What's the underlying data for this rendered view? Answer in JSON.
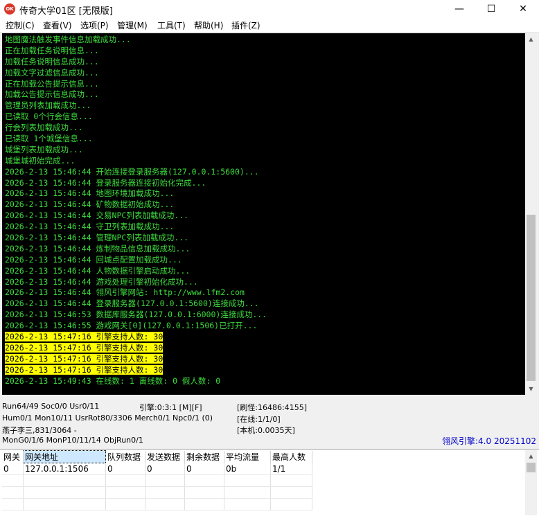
{
  "window": {
    "icon_text": "OK",
    "title": "传奇大学01区 [无限版]",
    "controls": {
      "minimize": "—",
      "maximize": "☐",
      "close": "✕"
    }
  },
  "menu": [
    "控制(C)",
    "查看(V)",
    "选项(P)",
    "管理(M)",
    "工具(T)",
    "帮助(H)",
    "插件(Z)"
  ],
  "console": {
    "text_color": "#3ddc3d",
    "highlight_color": "#ffff00",
    "lines": [
      "地图魔法触发事件信息加载成功...",
      "正在加载任务说明信息...",
      "加载任务说明信息成功...",
      "加载文字过滤信息成功...",
      "正在加载公告提示信息...",
      "加载公告提示信息成功...",
      "管理员列表加载成功...",
      "已读取 0个行会信息...",
      "行会列表加载成功...",
      "已读取 1个城堡信息...",
      "城堡列表加载成功...",
      "城堡城初始完成...",
      "2026-2-13 15:46:44 开始连接登录服务器(127.0.0.1:5600)...",
      "2026-2-13 15:46:44 登录服务器连接初始化完成...",
      "2026-2-13 15:46:44 地图环境加载成功...",
      "2026-2-13 15:46:44 矿物数据初始成功...",
      "2026-2-13 15:46:44 交易NPC列表加载成功...",
      "2026-2-13 15:46:44 守卫列表加载成功...",
      "2026-2-13 15:46:44 管理NPC列表加载成功...",
      "2026-2-13 15:46:44 炼制物品信息加载成功...",
      "2026-2-13 15:46:44 回城点配置加载成功...",
      "2026-2-13 15:46:44 人物数据引擎启动成功...",
      "2026-2-13 15:46:44 游戏处理引擎初始化成功...",
      "2026-2-13 15:46:44 翎风引擎网站: http://www.lfm2.com",
      "2026-2-13 15:46:44 登录服务器(127.0.0.1:5600)连接成功...",
      "2026-2-13 15:46:53 数据库服务器(127.0.0.1:6000)连接成功...",
      "2026-2-13 15:46:55 游戏网关[0](127.0.0.1:1506)已打开...",
      "2026-2-13 15:47:16 引擎支持人数: 30",
      "2026-2-13 15:47:16 引擎支持人数: 30",
      "2026-2-13 15:47:16 引擎支持人数: 30",
      "2026-2-13 15:47:16 引擎支持人数: 30",
      "2026-2-13 15:49:43 在线数: 1 离线数: 0 假人数: 0"
    ],
    "highlighted_lines": [
      27,
      28,
      29,
      30
    ]
  },
  "status": {
    "run": "Run64/49 Soc0/0 Usr0/11",
    "engine": "引擎:0:3:1 [M][F]",
    "monster": "[刷怪:16486:4155]",
    "hum": "Hum0/1 Mon10/11 UsrRot80/3306 Merch0/1 Npc0/1 (0)",
    "online": "[在线:1/1/0]",
    "player": "燕子李三,831/3064 -",
    "local": "[本机:0.0035天]",
    "mong": "MonG0/1/6 MonP10/11/14 ObjRun0/1",
    "version": "翎风引擎:4.0 20251102"
  },
  "gateway": {
    "headers": [
      "网关",
      "网关地址",
      "队列数据",
      "发送数据",
      "剩余数据",
      "平均流量",
      "最高人数"
    ],
    "rows": [
      [
        "0",
        "127.0.0.1:1506",
        "0",
        "0",
        "0",
        "0b",
        "1/1"
      ]
    ]
  }
}
